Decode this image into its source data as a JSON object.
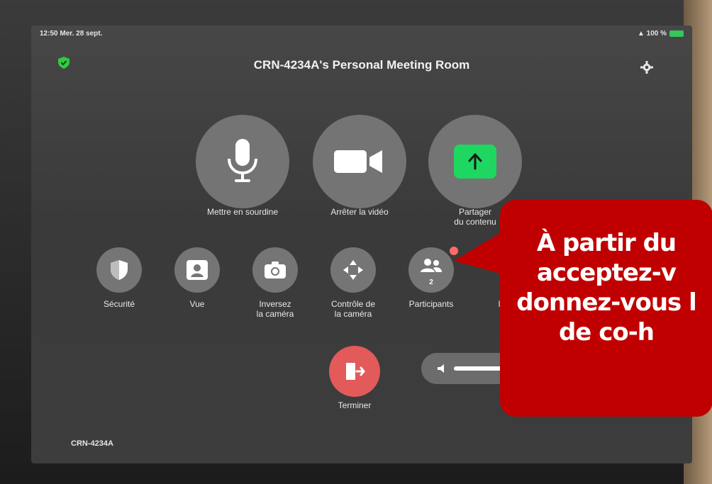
{
  "status_bar": {
    "time": "12:50",
    "date": "Mer. 28 sept.",
    "battery": "100 %"
  },
  "meeting": {
    "title": "CRN-4234A's Personal Meeting Room"
  },
  "main_controls": [
    {
      "label": "Mettre en sourdine",
      "icon": "microphone-icon"
    },
    {
      "label": "Arrêter la vidéo",
      "icon": "video-camera-icon"
    },
    {
      "label_line1": "Partager",
      "label_line2": "du contenu",
      "icon": "share-up-arrow-icon"
    }
  ],
  "secondary_controls": [
    {
      "label": "Sécurité",
      "icon": "shield-icon"
    },
    {
      "label": "Vue",
      "icon": "person-portrait-icon"
    },
    {
      "label_line1": "Inversez",
      "label_line2": "la caméra",
      "icon": "camera-switch-icon"
    },
    {
      "label_line1": "Contrôle de",
      "label_line2": "la caméra",
      "icon": "move-arrows-icon"
    },
    {
      "label": "Participants",
      "count": "2",
      "icon": "people-icon"
    },
    {
      "label": "I"
    }
  ],
  "end": {
    "label": "Terminer",
    "icon": "exit-door-icon"
  },
  "room_name": "CRN-4234A",
  "callout": {
    "line1": "À partir du",
    "line2": "acceptez-v",
    "line3": "donnez-vous l",
    "line4": "de co-h"
  },
  "colors": {
    "share_green": "#1ed760",
    "end_red": "#e25a5a",
    "callout_red": "#c00000",
    "secure_green": "#2ecc40"
  }
}
